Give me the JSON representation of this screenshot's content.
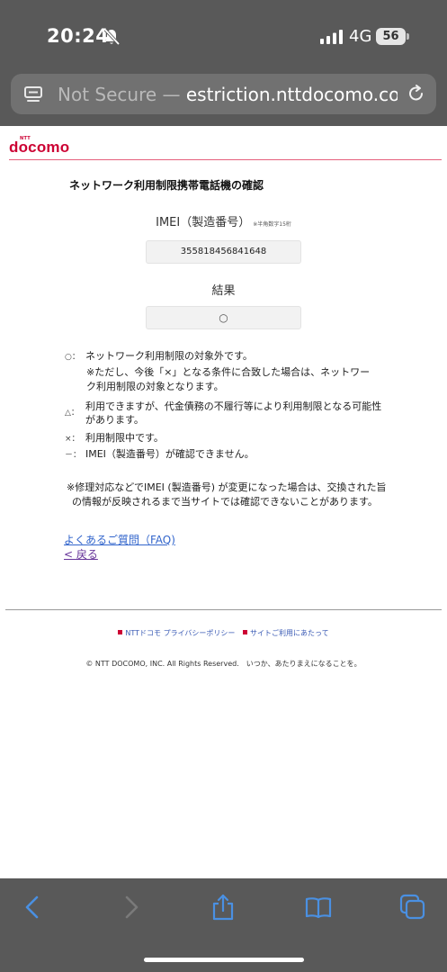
{
  "status_bar": {
    "time": "20:24",
    "network": "4G",
    "battery": "56"
  },
  "address_bar": {
    "security": "Not Secure — ",
    "url": "estriction.nttdocomo.co.jp"
  },
  "brand": {
    "ntt": "NTT",
    "name": "docomo",
    "color": "#cc0033"
  },
  "page": {
    "title": "ネットワーク利用制限携帯電話機の確認",
    "imei_label": "IMEI（製造番号）",
    "imei_note": "※半角数字15桁",
    "imei_value": "355818456841648",
    "result_label": "結果",
    "result_value": "○"
  },
  "legend": [
    {
      "symbol": "○：",
      "text": "ネットワーク利用制限の対象外です。"
    },
    {
      "symbol": "△：",
      "text": "利用できますが、代金債務の不履行等により利用制限となる可能性があります。"
    },
    {
      "symbol": "×：",
      "text": "利用制限中です。"
    },
    {
      "symbol": "－：",
      "text": "IMEI（製造番号）が確認できません。"
    }
  ],
  "legend_note": "※ただし、今後「×」となる条件に合致した場合は、ネットワーク利用制限の対象となります。",
  "repair_note": "※修理対応などでIMEI (製造番号) が変更になった場合は、交換された旨の情報が反映されるまで当サイトでは確認できないことがあります。",
  "links": {
    "faq": "よくあるご質問（FAQ)",
    "back": "< 戻る"
  },
  "footer": {
    "privacy": "NTTドコモ プライバシーポリシー",
    "terms": "サイトご利用にあたって",
    "copyright": "© NTT DOCOMO, INC. All Rights Reserved.　いつか、あたりまえになることを。"
  },
  "toolbar": {
    "icons": [
      "back-icon",
      "forward-icon",
      "share-icon",
      "bookmarks-icon",
      "tabs-icon"
    ],
    "accent": "#4a90e2"
  }
}
